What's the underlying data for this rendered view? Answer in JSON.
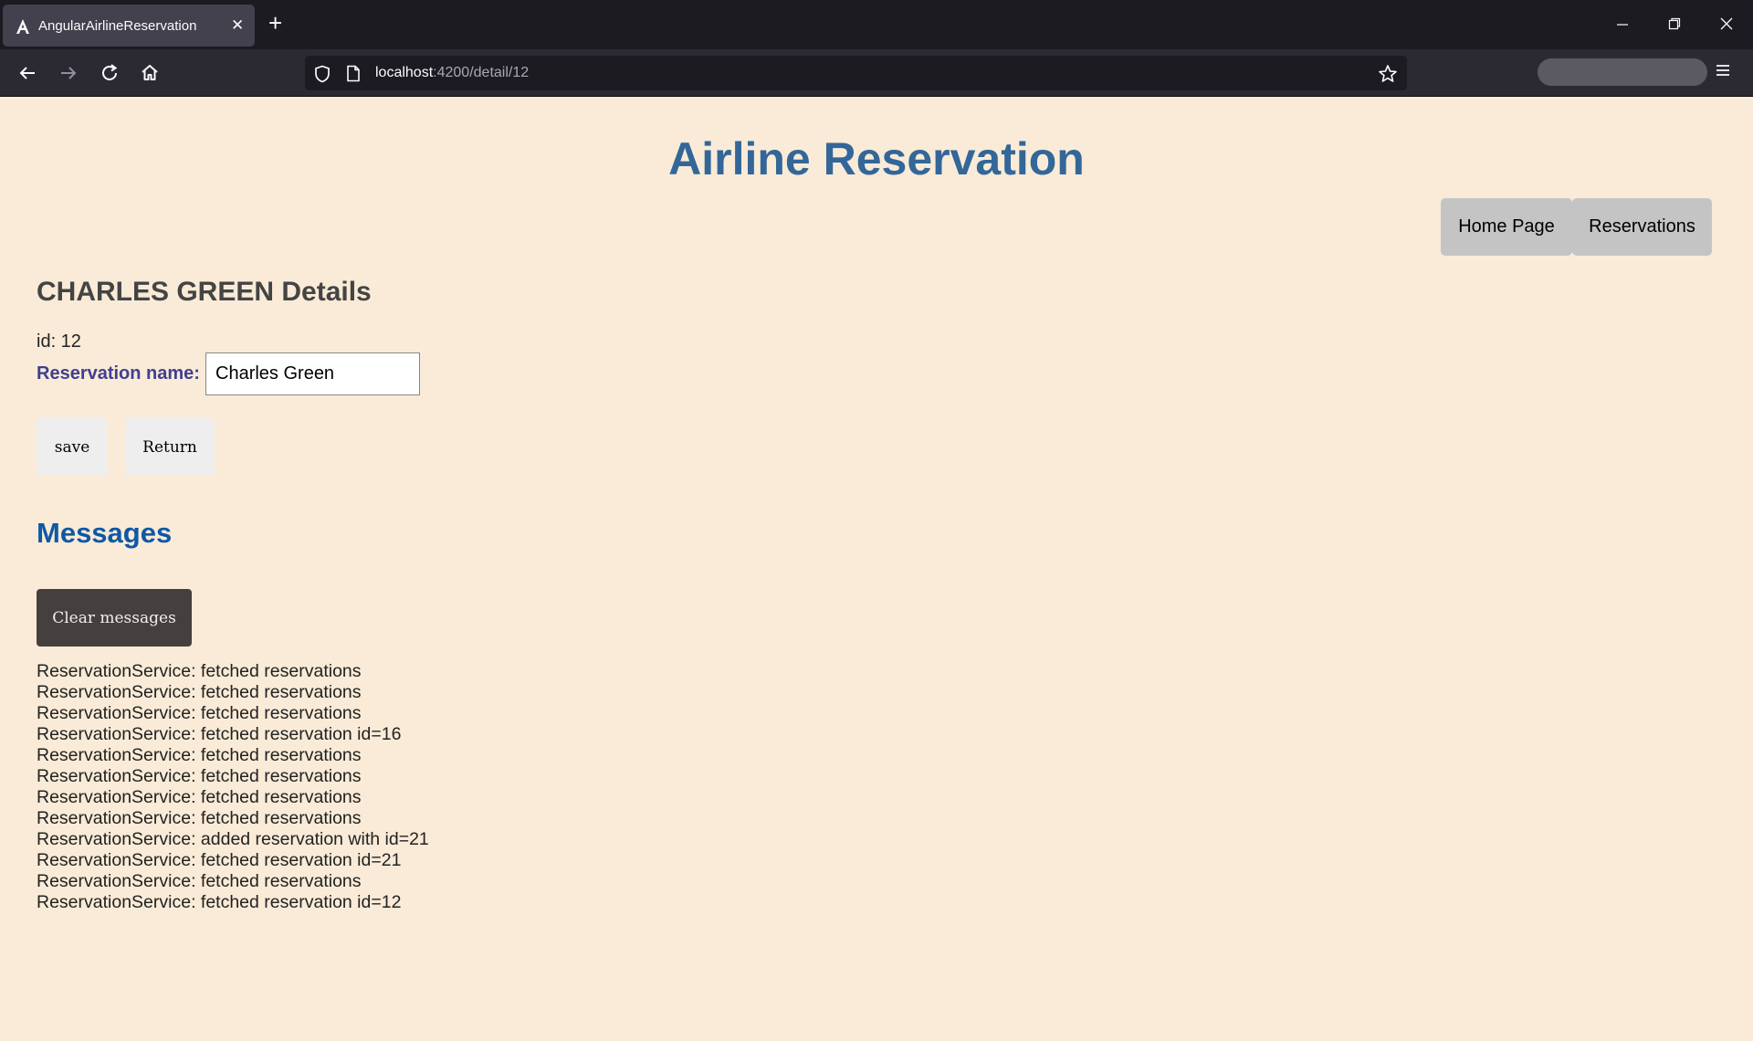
{
  "browser": {
    "tab_title": "AngularAirlineReservation",
    "url_host": "localhost",
    "url_path": ":4200/detail/12"
  },
  "app": {
    "title": "Airline Reservation",
    "nav": {
      "home_label": "Home Page",
      "reservations_label": "Reservations"
    }
  },
  "detail": {
    "heading": "CHARLES GREEN Details",
    "id_line": "id: 12",
    "name_label": "Reservation name:",
    "name_value": "Charles Green",
    "save_label": "save",
    "return_label": "Return"
  },
  "messages": {
    "heading": "Messages",
    "clear_label": "Clear messages",
    "items": [
      "ReservationService: fetched reservations",
      "ReservationService: fetched reservations",
      "ReservationService: fetched reservations",
      "ReservationService: fetched reservation id=16",
      "ReservationService: fetched reservations",
      "ReservationService: fetched reservations",
      "ReservationService: fetched reservations",
      "ReservationService: fetched reservations",
      "ReservationService: added reservation with id=21",
      "ReservationService: fetched reservation id=21",
      "ReservationService: fetched reservations",
      "ReservationService: fetched reservation id=12"
    ]
  }
}
